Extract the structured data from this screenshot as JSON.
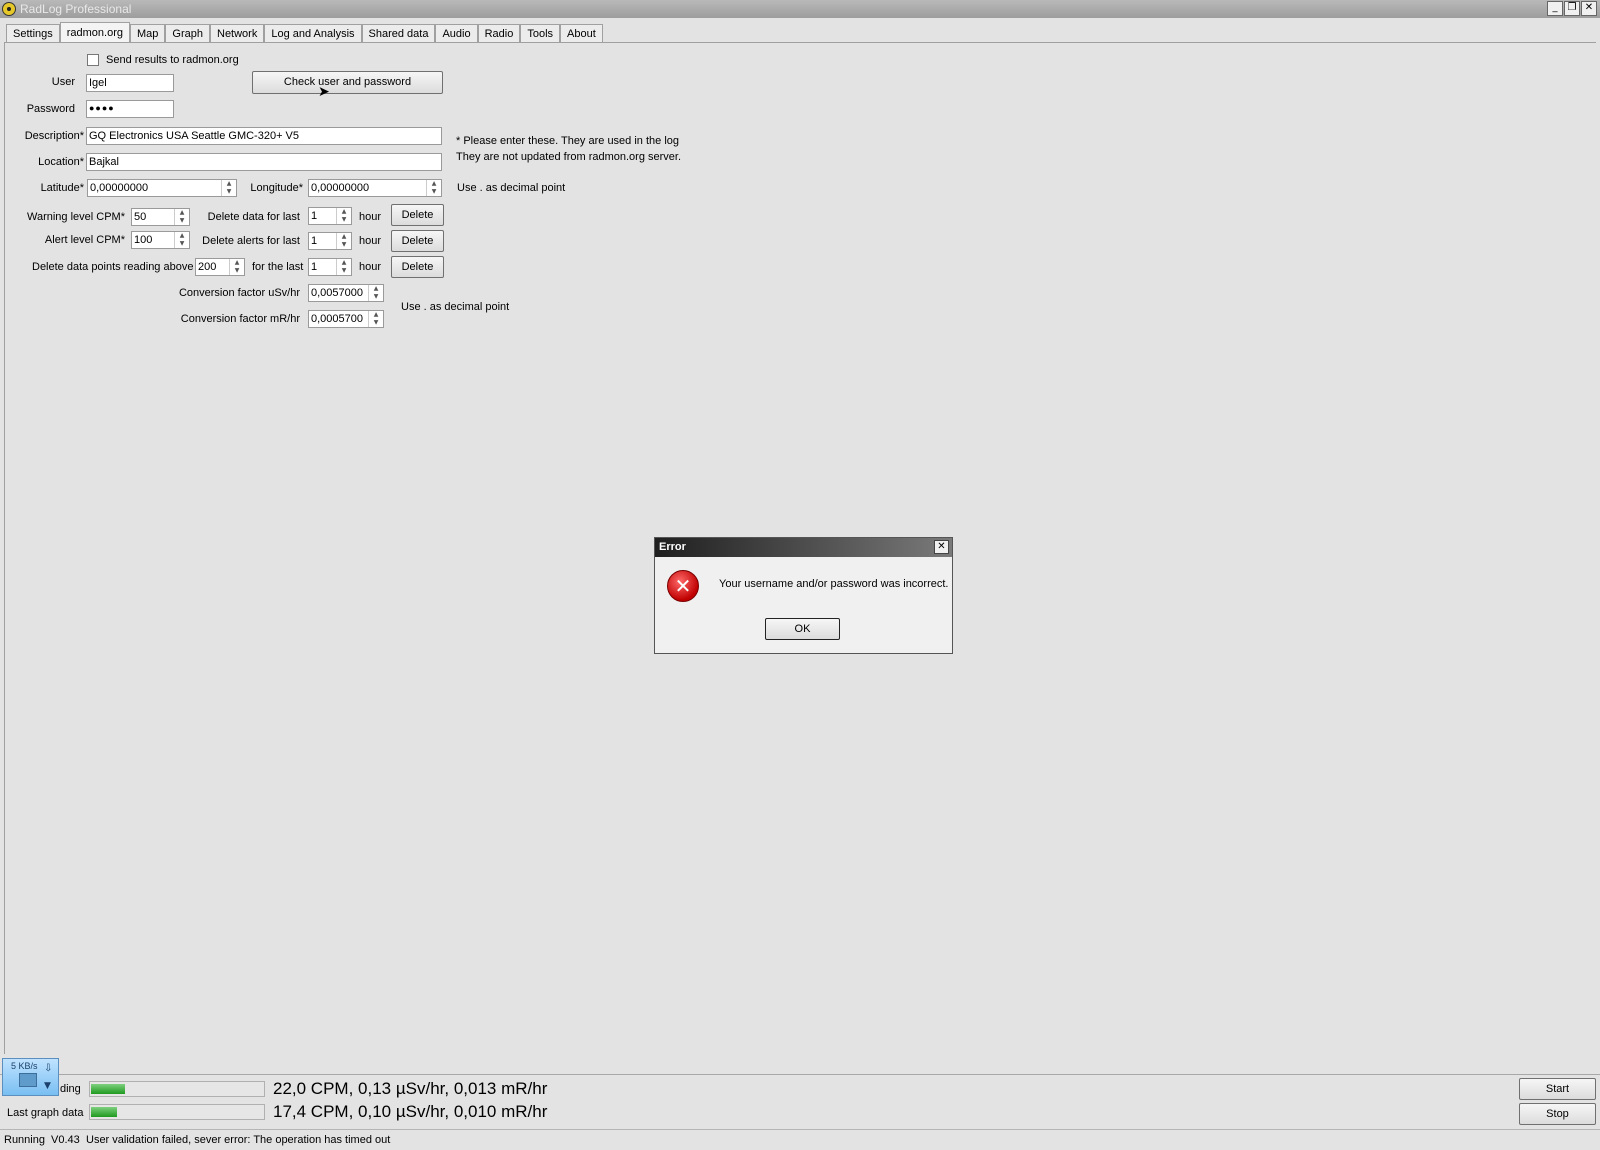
{
  "window": {
    "title": "RadLog Professional",
    "min": "_",
    "restore": "❐",
    "close": "✕"
  },
  "tabs": [
    "Settings",
    "radmon.org",
    "Map",
    "Graph",
    "Network",
    "Log and Analysis",
    "Shared data",
    "Audio",
    "Radio",
    "Tools",
    "About"
  ],
  "form": {
    "send_results_label": "Send results to radmon.org",
    "user_label": "User",
    "user_value": "Igel",
    "password_label": "Password",
    "password_value": "●●●●",
    "check_button": "Check user and password",
    "description_label": "Description*",
    "description_value": "GQ Electronics USA Seattle GMC-320+ V5",
    "location_label": "Location*",
    "location_value": "Bajkal",
    "note_line1": "* Please enter these. They are used in the log",
    "note_line2": "They are not updated from radmon.org server.",
    "latitude_label": "Latitude*",
    "latitude_value": "0,00000000",
    "longitude_label": "Longitude*",
    "longitude_value": "0,00000000",
    "decimal_note": "Use . as decimal point",
    "warning_label": "Warning level CPM*",
    "warning_value": "50",
    "alert_label": "Alert level CPM*",
    "alert_value": "100",
    "delete_data_label": "Delete data for last",
    "delete_data_value": "1",
    "delete_alerts_label": "Delete alerts for last",
    "delete_alerts_value": "1",
    "delete_above_label": "Delete data points reading above",
    "delete_above_value": "200",
    "for_last_label": "for the last",
    "for_last_value": "1",
    "hour": "hour",
    "delete_button": "Delete",
    "usv_label": "Conversion factor uSv/hr",
    "usv_value": "0,0057000",
    "mr_label": "Conversion factor mR/hr",
    "mr_value": "0,0005700",
    "decimal_note2": "Use . as decimal point"
  },
  "dialog": {
    "title": "Error",
    "close": "✕",
    "message": "Your username and/or password was incorrect.",
    "ok": "OK",
    "icon": "error-x-icon"
  },
  "bottom": {
    "net_speed": "5 KB/s",
    "row1_label": "ding",
    "row1_value": "22,0 CPM, 0,13 µSv/hr, 0,013 mR/hr",
    "row1_level": 0.2,
    "row2_label": "Last graph data",
    "row2_value": "17,4 CPM, 0,10 µSv/hr, 0,010 mR/hr",
    "row2_level": 0.15,
    "start": "Start",
    "stop": "Stop",
    "status_running": "Running",
    "status_version": "V0.43",
    "status_message": "User validation failed, sever error: The operation has timed out"
  },
  "colors": {
    "progress": "#1f9a1f",
    "error": "#c00000"
  }
}
